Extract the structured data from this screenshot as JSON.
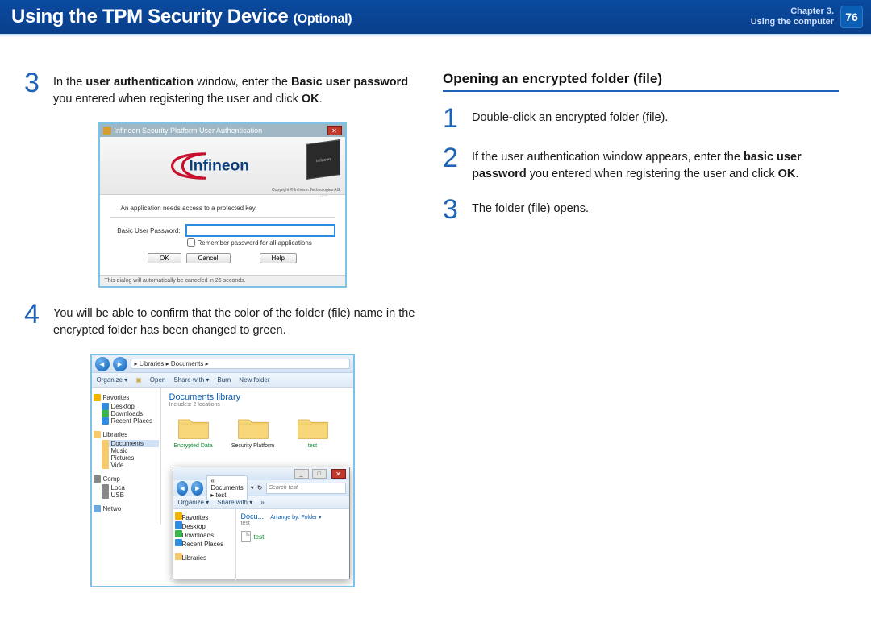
{
  "header": {
    "title_main": "Using the TPM Security Device",
    "title_suffix": "(Optional)",
    "chapter_line1": "Chapter 3.",
    "chapter_line2": "Using the computer",
    "page_number": "76"
  },
  "left": {
    "step3": {
      "num": "3",
      "pre": "In the ",
      "b1": "user authentication",
      "mid1": " window, enter the ",
      "b2": "Basic user password",
      "mid2": " you entered when registering the user and click ",
      "b3": "OK",
      "post": "."
    },
    "step4": {
      "num": "4",
      "text": "You will be able to confirm that the color of the folder (file) name in the encrypted folder has been changed to green."
    }
  },
  "right": {
    "heading": "Opening an encrypted folder (file)",
    "step1": {
      "num": "1",
      "text": "Double-click an encrypted folder (file)."
    },
    "step2": {
      "num": "2",
      "pre": "If the user authentication window appears, enter the ",
      "b1": "basic user password",
      "mid": " you entered when registering the user and click ",
      "b2": "OK",
      "post": "."
    },
    "step3": {
      "num": "3",
      "text": "The folder (file) opens."
    }
  },
  "auth_dialog": {
    "title": "Infineon Security Platform User Authentication",
    "logo_text": "Infineon",
    "copyright": "Copyright ©\nInfineon Technologies AG",
    "message": "An application needs access to a protected key.",
    "pw_label": "Basic User Password:",
    "remember": "Remember password for all applications",
    "btn_ok": "OK",
    "btn_cancel": "Cancel",
    "btn_help": "Help",
    "footer": "This dialog will automatically be canceled in 26 seconds."
  },
  "explorer": {
    "breadcrumb": "▸ Libraries ▸ Documents ▸",
    "toolbar": {
      "organize": "Organize ▾",
      "open": "Open",
      "share": "Share with ▾",
      "burn": "Burn",
      "newfolder": "New folder"
    },
    "tree": {
      "favorites": "Favorites",
      "desktop": "Desktop",
      "downloads": "Downloads",
      "recent": "Recent Places",
      "libraries": "Libraries",
      "documents": "Documents",
      "music": "Music",
      "pictures": "Pictures",
      "videos": "Vide",
      "computer": "Comp",
      "local": "Loca",
      "usb": "USB",
      "network": "Netwo"
    },
    "content": {
      "lib_title": "Documents library",
      "lib_sub": "Includes: 2 locations",
      "folders": [
        "Encrypted Data",
        "Security Platform",
        "test"
      ]
    }
  },
  "nested": {
    "breadcrumb": "« Documents ▸ test",
    "search_placeholder": "Search test",
    "toolbar": {
      "organize": "Organize ▾",
      "share": "Share with ▾",
      "more": "»"
    },
    "tree": {
      "favorites": "Favorites",
      "desktop": "Desktop",
      "downloads": "Downloads",
      "recent": "Recent Places",
      "libraries": "Libraries"
    },
    "content": {
      "head": "Docu...",
      "sub": "test",
      "arrange": "Arrange by:  Folder ▾",
      "file": "test"
    }
  }
}
